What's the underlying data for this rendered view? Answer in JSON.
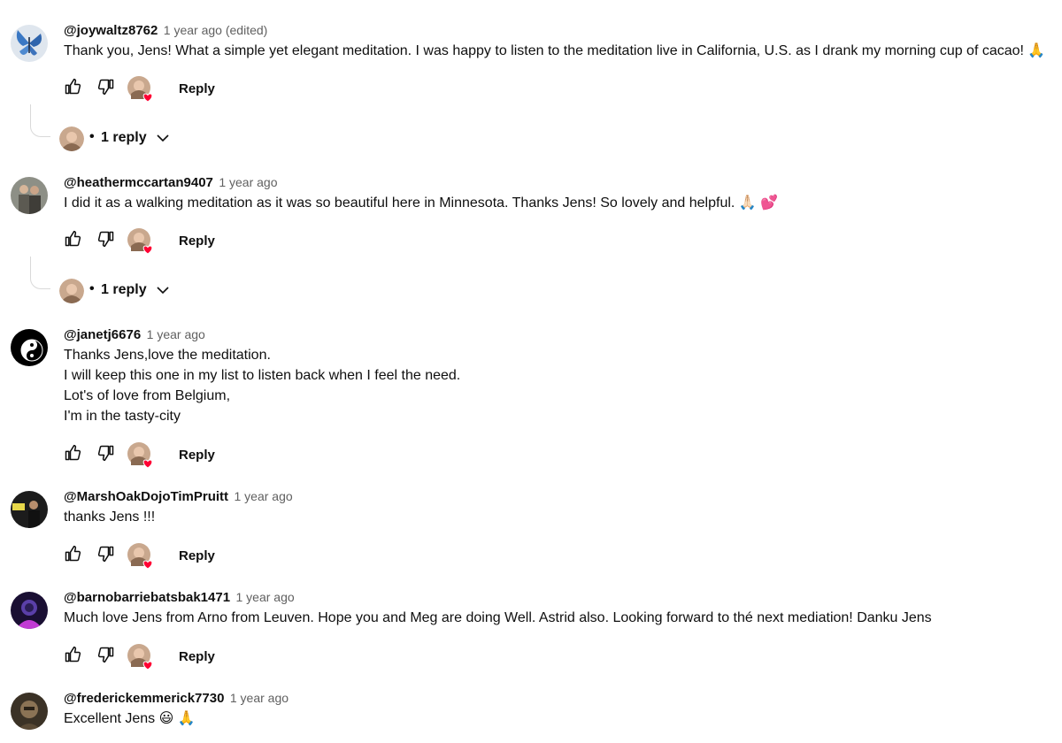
{
  "comments": [
    {
      "author": "@joywaltz8762",
      "time": "1 year ago (edited)",
      "lines": [
        "Thank you, Jens!  What a simple yet elegant meditation.  I was happy to listen to the meditation live in California, U.S. as I drank my morning cup of cacao! 🙏"
      ],
      "reply_label": "Reply",
      "replies": "1 reply",
      "avatar_icon": "butterfly-icon"
    },
    {
      "author": "@heathermccartan9407",
      "time": "1 year ago",
      "lines": [
        "I did it as a walking meditation as it was so beautiful here in Minnesota. Thanks Jens!  So lovely and helpful. 🙏🏻 💕"
      ],
      "reply_label": "Reply",
      "replies": "1 reply",
      "avatar_icon": "couple-photo-icon"
    },
    {
      "author": "@janetj6676",
      "time": "1 year ago",
      "lines": [
        "Thanks Jens,love the meditation.",
        "I will keep this one in my list to listen back when I feel the need.",
        "Lot's of love from Belgium,",
        "I'm in the tasty-city"
      ],
      "reply_label": "Reply",
      "avatar_icon": "yin-yang-icon"
    },
    {
      "author": "@MarshOakDojoTimPruitt",
      "time": "1 year ago",
      "lines": [
        "thanks Jens !!!"
      ],
      "reply_label": "Reply",
      "avatar_icon": "dojo-photo-icon"
    },
    {
      "author": "@barnobarriebatsbak1471",
      "time": "1 year ago",
      "lines": [
        "Much love Jens from Arno from Leuven. Hope you and Meg are doing Well. Astrid also. Looking forward to thé next mediation! Danku Jens"
      ],
      "reply_label": "Reply",
      "avatar_icon": "neon-portrait-icon"
    },
    {
      "author": "@frederickemmerick7730",
      "time": "1 year ago",
      "lines": [
        "Excellent Jens 😃 🙏"
      ],
      "avatar_icon": "portrait-photo-icon"
    }
  ],
  "colors": {
    "text": "#0f0f0f",
    "secondary": "#606060",
    "heart": "#ff0033",
    "thread_line": "#d9d9d9"
  }
}
